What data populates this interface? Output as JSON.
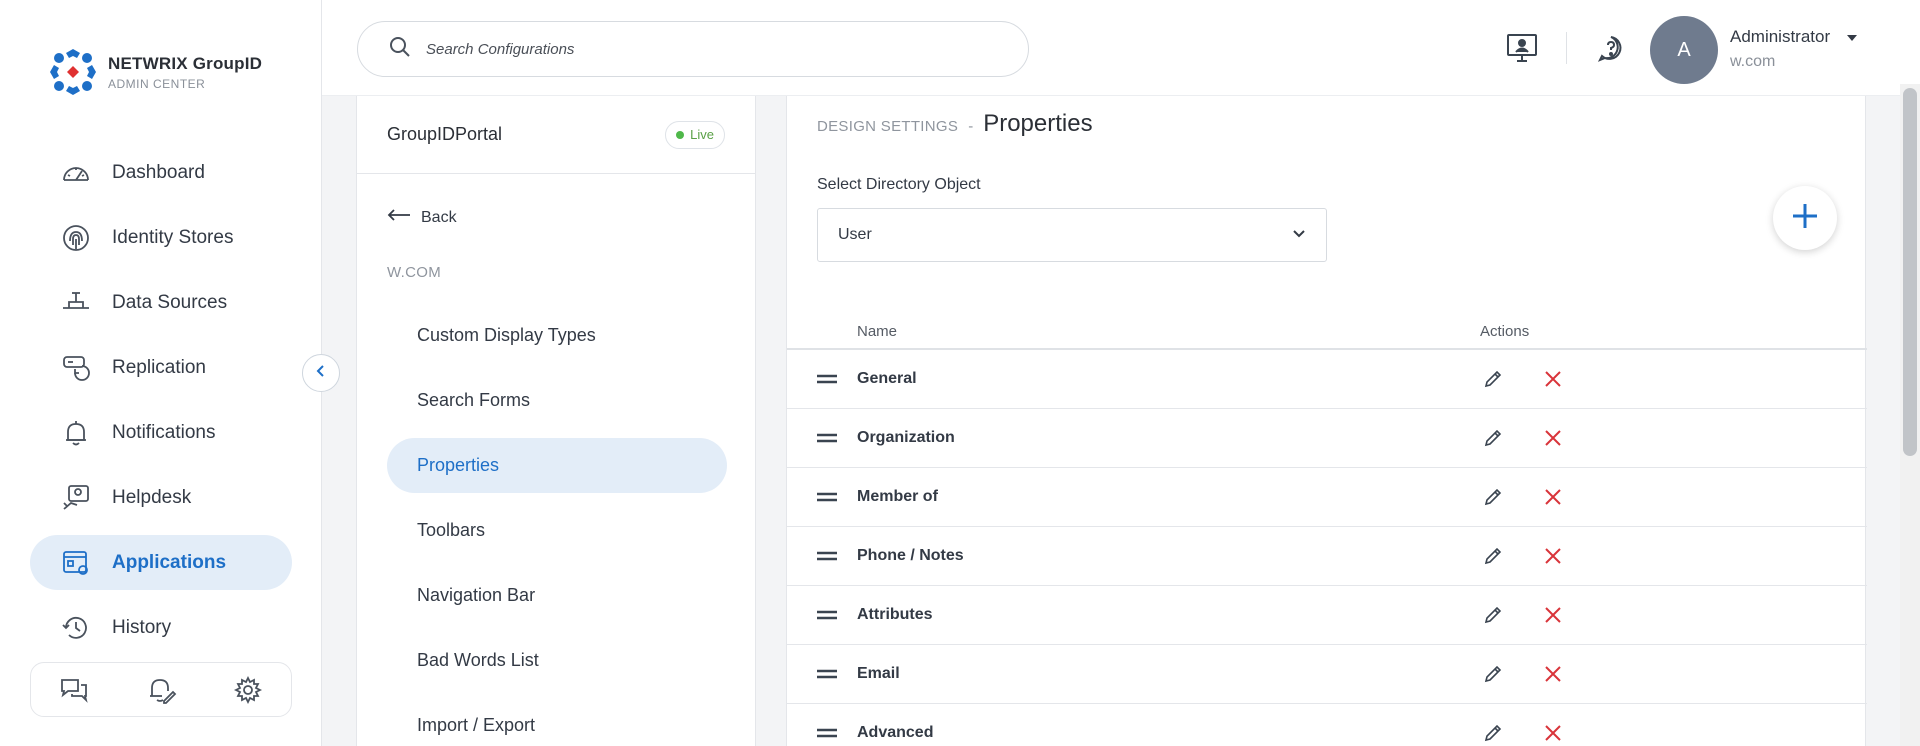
{
  "brand": {
    "title": "NETWRIX GroupID",
    "subtitle": "ADMIN CENTER"
  },
  "sidebar": {
    "items": [
      {
        "label": "Dashboard",
        "icon": "gauge-icon",
        "active": false
      },
      {
        "label": "Identity Stores",
        "icon": "fingerprint-icon",
        "active": false
      },
      {
        "label": "Data Sources",
        "icon": "database-plug-icon",
        "active": false
      },
      {
        "label": "Replication",
        "icon": "replication-icon",
        "active": false
      },
      {
        "label": "Notifications",
        "icon": "bell-icon",
        "active": false
      },
      {
        "label": "Helpdesk",
        "icon": "helpdesk-icon",
        "active": false
      },
      {
        "label": "Applications",
        "icon": "applications-icon",
        "active": true
      },
      {
        "label": "History",
        "icon": "history-icon",
        "active": false
      }
    ]
  },
  "topbar": {
    "search_placeholder": "Search Configurations",
    "user_initial": "A",
    "user_name": "Administrator",
    "user_domain": "w.com"
  },
  "app_panel": {
    "portal_name": "GroupIDPortal",
    "status": "Live",
    "back_label": "Back",
    "section_label": "W.COM",
    "menu": [
      {
        "label": "Custom Display Types",
        "active": false
      },
      {
        "label": "Search Forms",
        "active": false
      },
      {
        "label": "Properties",
        "active": true
      },
      {
        "label": "Toolbars",
        "active": false
      },
      {
        "label": "Navigation Bar",
        "active": false
      },
      {
        "label": "Bad Words List",
        "active": false
      },
      {
        "label": "Import / Export",
        "active": false
      }
    ]
  },
  "content": {
    "breadcrumb_section": "DESIGN SETTINGS",
    "breadcrumb_sep": "-",
    "page_title": "Properties",
    "select_label": "Select Directory Object",
    "select_value": "User",
    "table": {
      "headers": {
        "name": "Name",
        "actions": "Actions"
      },
      "rows": [
        "General",
        "Organization",
        "Member of",
        "Phone / Notes",
        "Attributes",
        "Email",
        "Advanced"
      ]
    }
  },
  "colors": {
    "accent": "#1e6fc7",
    "active_bg": "#e3edf8",
    "delete": "#d9343a",
    "live": "#4fb84a"
  }
}
